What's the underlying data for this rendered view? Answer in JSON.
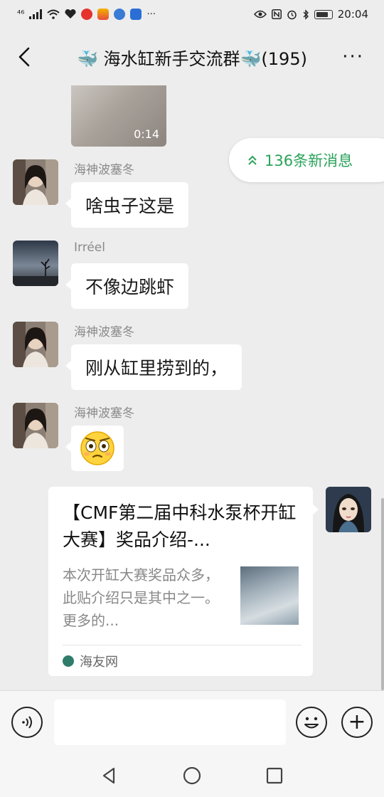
{
  "status_bar": {
    "network": "⁴⁶",
    "time": "20:04",
    "more_indicator": "···",
    "icons": [
      "signal-icon",
      "wifi-icon",
      "health-icon",
      "app-icon-red",
      "app-icon-orange",
      "music-icon",
      "app-icon-blue",
      "eye-icon",
      "nfc-icon",
      "alarm-icon",
      "bluetooth-icon",
      "battery-icon"
    ]
  },
  "header": {
    "title": "🐳 海水缸新手交流群🐳(195)",
    "back_icon": "chevron-left-icon",
    "more_icon": "more-icon"
  },
  "video": {
    "duration": "0:14"
  },
  "new_messages": {
    "label": "136条新消息",
    "icon": "double-chevron-up-icon",
    "color": "#2aa35a"
  },
  "messages": [
    {
      "sender": "海神波塞冬",
      "text": "啥虫子这是"
    },
    {
      "sender": "Irréel",
      "text": "不像边跳虾"
    },
    {
      "sender": "海神波塞冬",
      "text": "刚从缸里捞到的，"
    },
    {
      "sender": "海神波塞冬",
      "text": "😳"
    }
  ],
  "link_card": {
    "title": "【CMF第二届中科水泵杯开缸大赛】奖品介绍-...",
    "description": "本次开缸大赛奖品众多，此贴介绍只是其中之一。更多的...",
    "source": "海友网"
  },
  "input_bar": {
    "voice_icon": "voice-icon",
    "emoji_icon": "emoji-icon",
    "plus_icon": "plus-icon",
    "plus_glyph": "+"
  },
  "nav_bar": {
    "icons": [
      "back-triangle-icon",
      "home-circle-icon",
      "recents-square-icon"
    ]
  }
}
